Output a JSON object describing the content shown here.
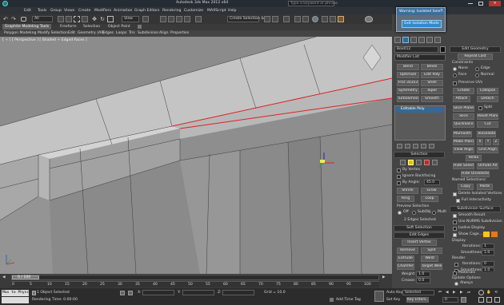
{
  "window": {
    "title": "Autodesk 3ds Max 2012 x64",
    "search_placeholder": "Type a keyword or phrase"
  },
  "menu": [
    "Edit",
    "Tools",
    "Group",
    "Views",
    "Create",
    "Modifiers",
    "Animation",
    "Graph Editors",
    "Rendering",
    "Customize",
    "MAXScript",
    "Help"
  ],
  "toolbar": {
    "selection_filter": "All",
    "view": "View",
    "named_sets": "Create Selection Se"
  },
  "ribbon": {
    "tabs": [
      "Graphite Modeling Tools",
      "Freeform",
      "Selection",
      "Object Paint"
    ],
    "subtabs": [
      "Polygon Modeling",
      "Modify Selection",
      "Edit",
      "Geometry (All)",
      "Edges",
      "Loops",
      "Tris",
      "Subdivision",
      "Align",
      "Properties"
    ]
  },
  "viewport": {
    "label": "[ + ] [ Perspective ] [ Shaded + Edged Faces ]"
  },
  "dialog": {
    "title": "Warning: Isolated Sele...",
    "button": "Exit Isolation Mode"
  },
  "command_panel": {
    "object_name": "Box012",
    "modifier_list": "Modifier List",
    "modifier_buttons": [
      [
        "Bend",
        "Bevel"
      ],
      [
        "Optimize",
        "Edit Poly"
      ],
      [
        "FFD 3x3x3",
        "Shell"
      ],
      [
        "Symmetry",
        "Taper"
      ],
      [
        "TurboSmooth",
        "Smooth"
      ]
    ],
    "stack_item": "Editable Poly",
    "selection": {
      "title": "Selection",
      "by_vertex": "By Vertex",
      "ignore_backfacing": "Ignore Backfacing",
      "by_angle": "By Angle:",
      "angle": "45.0",
      "shrink": "Shrink",
      "grow": "Grow",
      "ring": "Ring",
      "loop": "Loop",
      "preview": "Preview Selection",
      "off": "Off",
      "subobj": "SubObj",
      "multi": "Multi",
      "status": "2 Edges Selected"
    },
    "soft_selection": "Soft Selection",
    "edit_edges": {
      "title": "Edit Edges",
      "insert_vertex": "Insert Vertex",
      "remove": "Remove",
      "split": "Split",
      "extrude": "Extrude",
      "weld": "Weld",
      "chamfer": "Chamfer",
      "target_weld": "Target Weld",
      "bridge": "Bridge",
      "connect": "Connect",
      "create_shape": "Create Shape From Selection",
      "weight": "Weight:",
      "weight_val": "1.0",
      "crease": "Crease:",
      "crease_val": "0.0"
    },
    "edit_geometry": {
      "title": "Edit Geometry",
      "repeat_last": "Repeat Last",
      "constraints": "Constraints",
      "none": "None",
      "edge": "Edge",
      "face": "Face",
      "normal": "Normal",
      "preserve_uvs": "Preserve UVs",
      "create": "Create",
      "collapse": "Collapse",
      "attach": "Attach",
      "detach": "Detach",
      "slice_plane": "Slice Plane",
      "split": "Split",
      "slice": "Slice",
      "reset_plane": "Reset Plane",
      "quickslice": "QuickSlice",
      "cut": "Cut",
      "meshsmooth": "MSmooth",
      "tessellate": "Tessellate",
      "make_planar": "Make Planar",
      "x": "X",
      "y": "Y",
      "z": "Z",
      "view_align": "View Align",
      "grid_align": "Grid Align",
      "relax": "Relax",
      "hide_selected": "Hide Selected",
      "unhide_all": "Unhide All",
      "hide_unselected": "Hide Unselected",
      "named_selections": "Named Selections:",
      "copy": "Copy",
      "paste": "Paste",
      "delete_isolated": "Delete Isolated Vertices",
      "full_interactivity": "Full Interactivity"
    },
    "subdivision_surface": {
      "title": "Subdivision Surface",
      "smooth_result": "Smooth Result",
      "use_nurms": "Use NURMS Subdivision",
      "isoline": "Isoline Display",
      "show_cage": "Show Cage......",
      "display": "Display",
      "iterations": "Iterations:",
      "iterations_val": "1",
      "smoothness": "Smoothness:",
      "smoothness_val": "1.0",
      "render": "Render",
      "render_iterations_val": "0",
      "render_smoothness_val": "1.0",
      "separate_by": "Separate By",
      "smoothing_groups": "Smoothing Groups",
      "materials": "Materials",
      "update_options": "Update Options",
      "always": "Always",
      "when_rendering": "When Rendering",
      "manually": "Manually"
    },
    "colors": {
      "cage1": "#f5c518",
      "cage2": "#e07b1a",
      "accent": "#2f6a9a"
    }
  },
  "timeline": {
    "frame": "0 / 100",
    "ticks": [
      "0",
      "5",
      "10",
      "15",
      "20",
      "25",
      "30",
      "35",
      "40",
      "45",
      "50",
      "55",
      "60",
      "65",
      "70",
      "75",
      "80",
      "85",
      "90",
      "95",
      "100"
    ]
  },
  "status": {
    "maxscript": "Max to Physc",
    "selected": "1 Object Selected",
    "rendering_time": "Rendering Time: 0:00:00",
    "x": "X:",
    "y": "Y:",
    "z": "Z:",
    "grid": "Grid = 10.0",
    "auto_key": "Auto Key",
    "selected_dropdown": "Selected",
    "set_key": "Set Key",
    "key_filters": "Key Filters...",
    "add_time_tag": "Add Time Tag",
    "frame_field": "0"
  }
}
